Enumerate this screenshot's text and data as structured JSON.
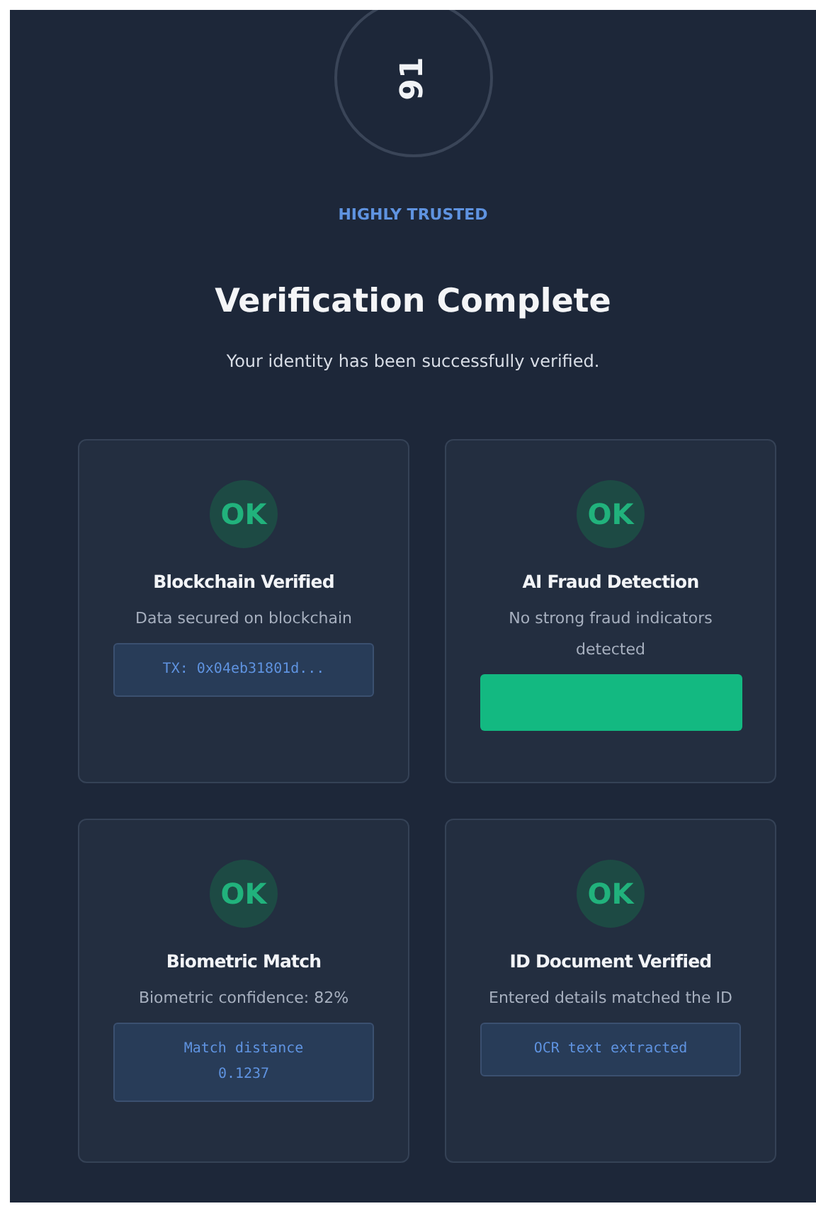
{
  "score": "91",
  "trust_label": "HIGHLY TRUSTED",
  "title": "Verification Complete",
  "subtitle": "Your identity has been successfully verified.",
  "cards": [
    {
      "badge": "OK",
      "title": "Blockchain Verified",
      "description": "Data secured on blockchain",
      "kind": "code",
      "detail": "TX: 0x04eb31801d..."
    },
    {
      "badge": "OK",
      "title": "AI Fraud Detection",
      "description": "No strong fraud indicators detected",
      "kind": "meter",
      "level": 1
    },
    {
      "badge": "OK",
      "title": "Biometric Match",
      "description": "Biometric confidence: 82%",
      "kind": "code",
      "detail": "Match distance 0.1237"
    },
    {
      "badge": "OK",
      "title": "ID Document Verified",
      "description": "Entered details matched the ID",
      "kind": "code",
      "detail": "OCR text extracted"
    }
  ]
}
